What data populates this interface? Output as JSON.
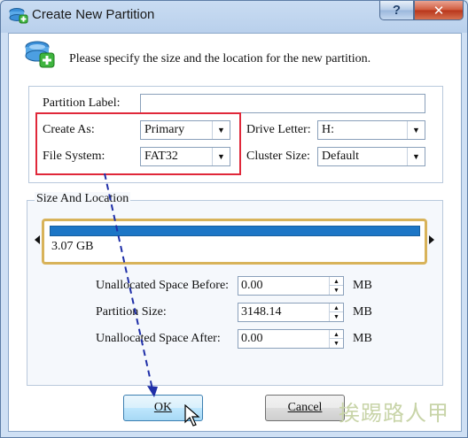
{
  "window": {
    "title": "Create New Partition",
    "help_label": "?",
    "close_label": "✕"
  },
  "header": {
    "instruction": "Please specify the size and the location for the new partition."
  },
  "partition_options": {
    "label_caption": "Partition Label:",
    "label_value": "",
    "create_as_caption": "Create As:",
    "create_as_value": "Primary",
    "file_system_caption": "File System:",
    "file_system_value": "FAT32",
    "drive_letter_caption": "Drive Letter:",
    "drive_letter_value": "H:",
    "cluster_size_caption": "Cluster Size:",
    "cluster_size_value": "Default"
  },
  "size_location": {
    "group_label": "Size And Location",
    "bar_label": "3.07 GB",
    "fill_fraction": 1.0,
    "unalloc_before_caption": "Unallocated Space Before:",
    "unalloc_before_value": "0.00",
    "partition_size_caption": "Partition Size:",
    "partition_size_value": "3148.14",
    "unalloc_after_caption": "Unallocated Space After:",
    "unalloc_after_value": "0.00",
    "unit": "MB"
  },
  "buttons": {
    "ok_label": "OK",
    "cancel_label": "Cancel"
  },
  "watermark": "挨踢路人甲",
  "colors": {
    "highlight_box": "#e0283a",
    "annotation_arrow": "#1f2fa8",
    "bar_fill": "#1c76c6",
    "bar_border": "#d8b35a"
  },
  "icons": [
    "partition-add-icon",
    "dropdown-arrow-icon",
    "spin-up-icon",
    "spin-down-icon",
    "mouse-cursor-icon"
  ]
}
